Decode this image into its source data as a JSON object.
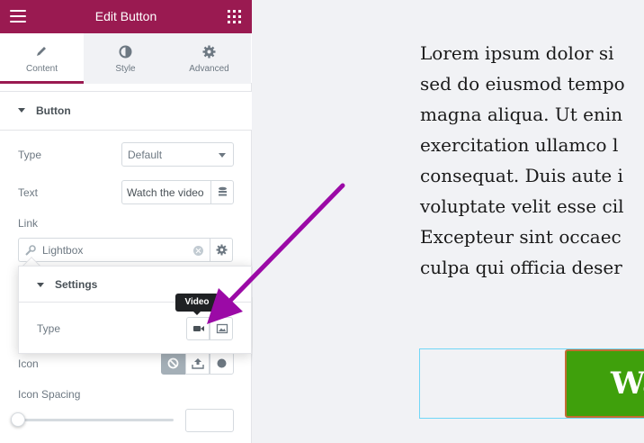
{
  "header": {
    "title": "Edit Button"
  },
  "tabs": [
    {
      "label": "Content",
      "icon": "pencil-icon"
    },
    {
      "label": "Style",
      "icon": "half-circle-icon"
    },
    {
      "label": "Advanced",
      "icon": "gear-icon"
    }
  ],
  "section": {
    "title": "Button"
  },
  "fields": {
    "type": {
      "label": "Type",
      "value": "Default"
    },
    "text": {
      "label": "Text",
      "value": "Watch the video"
    },
    "link": {
      "label": "Link",
      "value": "Lightbox"
    },
    "icon": {
      "label": "Icon"
    },
    "icon_spacing": {
      "label": "Icon Spacing"
    }
  },
  "popover": {
    "title": "Settings",
    "type_label": "Type",
    "tooltip": "Video"
  },
  "preview": {
    "lines": [
      "Lorem ipsum dolor si",
      "sed do eiusmod tempo",
      "magna aliqua. Ut enin",
      "exercitation ullamco l",
      "consequat. Duis aute i",
      "voluptate velit esse cil",
      "Excepteur sint occaec",
      "culpa qui officia deser"
    ],
    "button_text": "Wa"
  },
  "colors": {
    "brand": "#9a1a51",
    "annotation_arrow": "#9b0aa6",
    "button_bg": "#3fa00c"
  }
}
